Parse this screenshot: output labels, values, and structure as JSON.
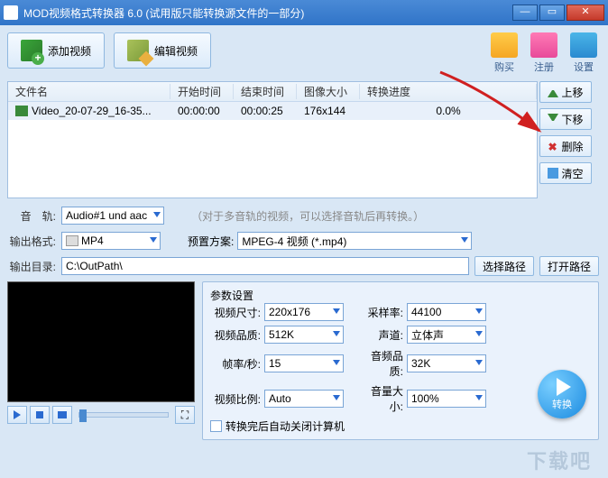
{
  "titlebar": {
    "title": "MOD视频格式转换器 6.0 (试用版只能转换源文件的一部分)"
  },
  "toolbar": {
    "add_video": "添加视频",
    "edit_video": "编辑视频"
  },
  "top_icons": {
    "buy": "购买",
    "register": "注册",
    "settings": "设置"
  },
  "table": {
    "headers": {
      "filename": "文件名",
      "start_time": "开始时间",
      "end_time": "结束时间",
      "image_size": "图像大小",
      "progress": "转换进度"
    },
    "rows": [
      {
        "filename": "Video_20-07-29_16-35...",
        "start": "00:00:00",
        "end": "00:00:25",
        "size": "176x144",
        "progress": "0.0%"
      }
    ]
  },
  "side_buttons": {
    "up": "上移",
    "down": "下移",
    "delete": "删除",
    "clear": "清空"
  },
  "audio": {
    "label": "音　轨:",
    "value": "Audio#1 und aac",
    "hint": "（对于多音轨的视频，可以选择音轨后再转换。）"
  },
  "output_format": {
    "label": "输出格式:",
    "value": "MP4",
    "preset_label": "预置方案:",
    "preset_value": "MPEG-4 视频 (*.mp4)"
  },
  "output_dir": {
    "label": "输出目录:",
    "value": "C:\\OutPath\\",
    "choose": "选择路径",
    "open": "打开路径"
  },
  "params": {
    "legend": "参数设置",
    "video_size_label": "视频尺寸:",
    "video_size": "220x176",
    "sample_rate_label": "采样率:",
    "sample_rate": "44100",
    "video_quality_label": "视频品质:",
    "video_quality": "512K",
    "channel_label": "声道:",
    "channel": "立体声",
    "fps_label": "帧率/秒:",
    "fps": "15",
    "audio_quality_label": "音频品质:",
    "audio_quality": "32K",
    "aspect_label": "视频比例:",
    "aspect": "Auto",
    "volume_label": "音量大小:",
    "volume": "100%",
    "shutdown": "转换完后自动关闭计算机"
  },
  "convert": "转换",
  "watermark": "下载吧"
}
